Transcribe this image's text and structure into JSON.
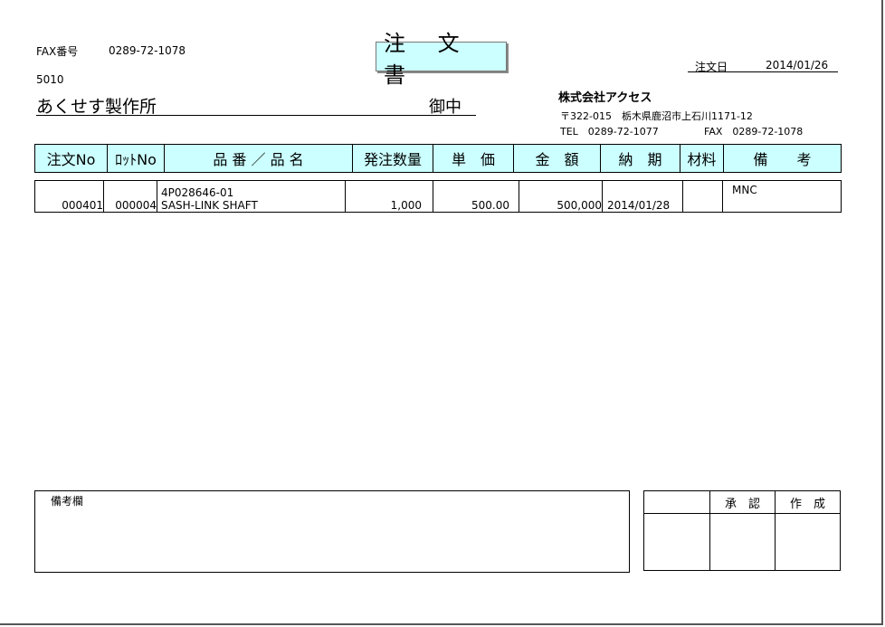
{
  "header": {
    "fax_label": "FAX番号",
    "fax_number": "0289-72-1078",
    "code": "5010",
    "recipient": "あくせす製作所",
    "honorific": "御中",
    "title": "注 文 書",
    "order_date_label": "注文日",
    "order_date": "2014/01/26"
  },
  "company": {
    "name": "株式会社アクセス",
    "address": "〒322-015　栃木県鹿沼市上石川1171-12",
    "tel": "TEL　0289-72-1077",
    "fax": "FAX　0289-72-1078"
  },
  "table": {
    "headers": [
      "注文No",
      "ﾛｯﾄNo",
      "品 番 ／ 品 名",
      "発注数量",
      "単　価",
      "金　額",
      "納　期",
      "材料",
      "備　　考"
    ],
    "rows": [
      {
        "order_no": "000401",
        "lot_no": "000004",
        "part_no": "4P028646-01",
        "part_name": "SASH-LINK SHAFT",
        "quantity": "1,000",
        "unit_price": "500.00",
        "amount": "500,000",
        "delivery": "2014/01/28",
        "material": "",
        "remarks": "MNC"
      }
    ]
  },
  "footer": {
    "remarks_label": "備考欄",
    "approve_label": "承　認",
    "create_label": "作　成"
  }
}
